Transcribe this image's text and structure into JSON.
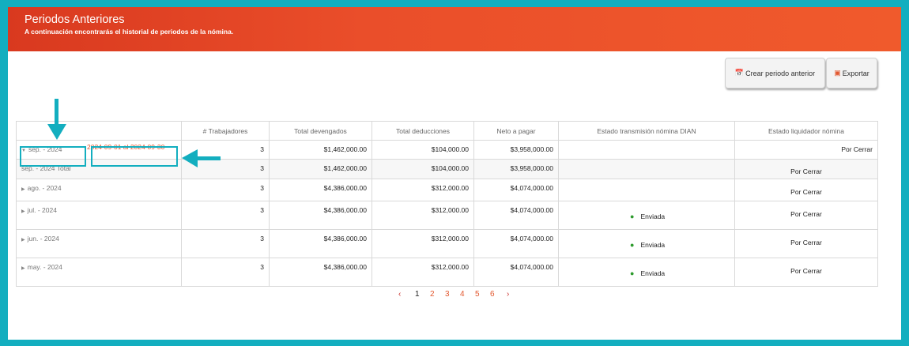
{
  "header": {
    "title": "Periodos Anteriores",
    "subtitle": "A continuación encontrarás el historial de periodos de la nómina."
  },
  "toolbar": {
    "create_label": "Crear periodo anterior",
    "export_label": "Exportar"
  },
  "table": {
    "columns": [
      "",
      "# Trabajadores",
      "Total devengados",
      "Total deducciones",
      "Neto a pagar",
      "Estado transmisión nómina DIAN",
      "Estado liquidador nómina"
    ],
    "date_range": "2024-09-01 al 2024-09-30",
    "rows": [
      {
        "period": "sep. - 2024",
        "workers": "3",
        "accrued": "$1,462,000.00",
        "deductions": "$104,000.00",
        "net": "$3,958,000.00",
        "dian": "",
        "liquidator": "Por Cerrar"
      },
      {
        "period": "sep. - 2024 Total",
        "workers": "3",
        "accrued": "$1,462,000.00",
        "deductions": "$104,000.00",
        "net": "$3,958,000.00",
        "dian": "",
        "liquidator": "Por Cerrar"
      },
      {
        "period": "ago. - 2024",
        "workers": "3",
        "accrued": "$4,386,000.00",
        "deductions": "$312,000.00",
        "net": "$4,074,000.00",
        "dian": "",
        "liquidator": "Por Cerrar"
      },
      {
        "period": "jul. - 2024",
        "workers": "3",
        "accrued": "$4,386,000.00",
        "deductions": "$312,000.00",
        "net": "$4,074,000.00",
        "dian": "Enviada",
        "liquidator": "Por Cerrar"
      },
      {
        "period": "jun. - 2024",
        "workers": "3",
        "accrued": "$4,386,000.00",
        "deductions": "$312,000.00",
        "net": "$4,074,000.00",
        "dian": "Enviada",
        "liquidator": "Por Cerrar"
      },
      {
        "period": "may. - 2024",
        "workers": "3",
        "accrued": "$4,386,000.00",
        "deductions": "$312,000.00",
        "net": "$4,074,000.00",
        "dian": "Enviada",
        "liquidator": "Por Cerrar"
      }
    ]
  },
  "pagination": {
    "prev": "‹",
    "pages": [
      "1",
      "2",
      "3",
      "4",
      "5",
      "6"
    ],
    "current": "1",
    "next": "›"
  },
  "colors": {
    "header": "#ea4e2a",
    "frame": "#13aebf",
    "accent": "#e2572e",
    "status_sent": "#2e9b2e"
  },
  "icons": [
    "calendar-icon",
    "export-icon",
    "caret-down-icon",
    "caret-right-icon",
    "arrow-down-icon",
    "arrow-left-icon"
  ]
}
